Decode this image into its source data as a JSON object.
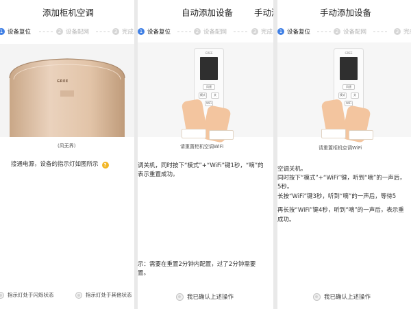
{
  "panel1": {
    "title": "添加柜机空调",
    "steps": [
      {
        "num": "1",
        "label": "设备复位",
        "active": true
      },
      {
        "num": "2",
        "label": "设备配网",
        "active": false
      },
      {
        "num": "3",
        "label": "完成",
        "active": false
      }
    ],
    "product_logo": "GREE",
    "product_caption": "(风无界)",
    "instruction": "接通电源，设备的指示灯如图所示",
    "help_glyph": "?",
    "options": [
      "指示灯处于闪烁状态",
      "指示灯处于其他状态"
    ]
  },
  "panel2": {
    "title": "自动添加设备",
    "title_right": "手动添",
    "steps": [
      {
        "num": "1",
        "label": "设备复位",
        "active": true
      },
      {
        "num": "2",
        "label": "设备配网",
        "active": false
      },
      {
        "num": "3",
        "label": "完成",
        "active": false
      }
    ],
    "image_caption": "请重置柜机空调WiFi",
    "instructions": [
      "调关机，同时按下“模式”+“WiFi”键1秒，“嘀”的",
      "表示重置成功。"
    ],
    "note": [
      "示：需要在重置2分钟内配置，过了2分钟需要",
      "置。"
    ],
    "confirm": "我已确认上述操作"
  },
  "panel3": {
    "title": "手动添加设备",
    "steps": [
      {
        "num": "1",
        "label": "设备复位",
        "active": true
      },
      {
        "num": "2",
        "label": "设备配网",
        "active": false
      },
      {
        "num": "3",
        "label": "完成",
        "active": false
      }
    ],
    "image_caption": "请重置柜机空调WiFi",
    "instructions": [
      "空调关机。",
      "同时按下“模式”+“WiFi”键，听到“嘀”的一声后，",
      "5秒。",
      "长按“WiFi”键3秒，听到“嘀”的一声后，等待5",
      "再长按“WiFi”键4秒，听到“嘀”的一声后，表示重",
      "成功。"
    ],
    "confirm": "我已确认上述操作"
  },
  "remote": {
    "brand": "GREE",
    "keys": [
      "风速",
      "关",
      "模式",
      "WiFi"
    ]
  },
  "colors": {
    "accent": "#3f7fe5",
    "help": "#f2b626",
    "divider": "#e9e9e9",
    "unit_gold": "#d9ba9c"
  }
}
